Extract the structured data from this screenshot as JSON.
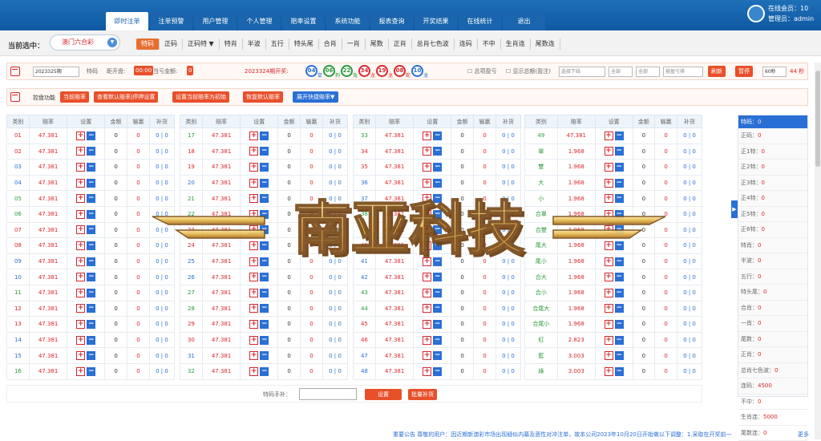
{
  "topnav": [
    "即时注单",
    "注单预警",
    "用户管理",
    "个人管理",
    "赔率设置",
    "系统功能",
    "报表查询",
    "开奖结果",
    "在线统计",
    "退出"
  ],
  "topinfo": {
    "online": "在线会员：10",
    "admin": "管理员：admin"
  },
  "current": {
    "label": "当前选中：",
    "value": "澳门六合彩"
  },
  "playtabs": [
    "特码",
    "正码",
    "正码特 ▼",
    "特肖",
    "半波",
    "五行",
    "特头尾",
    "合肖",
    "一肖",
    "尾数",
    "正肖",
    "总肖七色波",
    "连码",
    "不中",
    "生肖连",
    "尾数连"
  ],
  "ctrl1": {
    "period": "2023325期",
    "tema": "特码",
    "countdown_label": "距开盘:",
    "countdown": "00:00",
    "profit_label": "当亏金额:",
    "profit": "0",
    "last_label": "2023324期开奖:",
    "balls": [
      {
        "n": "04",
        "z": "鼠",
        "c": "blue"
      },
      {
        "n": "06",
        "z": "狗",
        "c": "green"
      },
      {
        "n": "22",
        "z": "兔",
        "c": "green"
      },
      {
        "n": "34",
        "z": "龙",
        "c": "red"
      },
      {
        "n": "19",
        "z": "龙",
        "c": "red"
      },
      {
        "n": "08",
        "z": "蛇",
        "c": "red"
      },
      {
        "n": "10",
        "z": "龙",
        "c": "blue"
      }
    ],
    "chk1": "总项盈亏",
    "chk2": "显示总额(盈注)",
    "sel1": "选择下线",
    "sel2": "全部",
    "sel3": "全部",
    "sel4": "按盈亏排",
    "refresh": "刷新",
    "pause": "暂停",
    "timer": "60秒",
    "timer_right": "44 秒"
  },
  "ctrl2": {
    "label": "控盘功能",
    "b1": "当前赔率",
    "b2": "查看默认赔率|停押设置",
    "b3": "设置当前赔率为初始",
    "b4": "恢复默认赔率",
    "b5": "展开快捷赔率▼"
  },
  "headers": [
    "类别",
    "赔率",
    "设置",
    "金额",
    "输赢",
    "补货"
  ],
  "table1": [
    {
      "k": "01",
      "c": "red"
    },
    {
      "k": "02",
      "c": "red"
    },
    {
      "k": "03",
      "c": "blue"
    },
    {
      "k": "04",
      "c": "blue"
    },
    {
      "k": "05",
      "c": "green"
    },
    {
      "k": "06",
      "c": "green"
    },
    {
      "k": "07",
      "c": "red"
    },
    {
      "k": "08",
      "c": "red"
    },
    {
      "k": "09",
      "c": "blue"
    },
    {
      "k": "10",
      "c": "blue"
    },
    {
      "k": "11",
      "c": "green"
    },
    {
      "k": "12",
      "c": "red"
    },
    {
      "k": "13",
      "c": "red"
    },
    {
      "k": "14",
      "c": "blue"
    },
    {
      "k": "15",
      "c": "blue"
    },
    {
      "k": "16",
      "c": "green"
    }
  ],
  "table2": [
    {
      "k": "17",
      "c": "green"
    },
    {
      "k": "18",
      "c": "red"
    },
    {
      "k": "19",
      "c": "red"
    },
    {
      "k": "20",
      "c": "blue"
    },
    {
      "k": "21",
      "c": "green"
    },
    {
      "k": "22",
      "c": "green"
    },
    {
      "k": "23",
      "c": "red"
    },
    {
      "k": "24",
      "c": "red"
    },
    {
      "k": "25",
      "c": "blue"
    },
    {
      "k": "26",
      "c": "blue"
    },
    {
      "k": "27",
      "c": "green"
    },
    {
      "k": "28",
      "c": "green"
    },
    {
      "k": "29",
      "c": "red"
    },
    {
      "k": "30",
      "c": "red"
    },
    {
      "k": "31",
      "c": "blue"
    },
    {
      "k": "32",
      "c": "green"
    }
  ],
  "table3": [
    {
      "k": "33",
      "c": "green"
    },
    {
      "k": "34",
      "c": "red"
    },
    {
      "k": "35",
      "c": "red"
    },
    {
      "k": "36",
      "c": "blue"
    },
    {
      "k": "37",
      "c": "blue"
    },
    {
      "k": "38",
      "c": "green"
    },
    {
      "k": "39",
      "c": "green"
    },
    {
      "k": "40",
      "c": "red"
    },
    {
      "k": "41",
      "c": "blue"
    },
    {
      "k": "42",
      "c": "blue"
    },
    {
      "k": "43",
      "c": "green"
    },
    {
      "k": "44",
      "c": "green"
    },
    {
      "k": "45",
      "c": "red"
    },
    {
      "k": "46",
      "c": "red"
    },
    {
      "k": "47",
      "c": "blue"
    },
    {
      "k": "48",
      "c": "blue"
    }
  ],
  "table4": [
    {
      "k": "49",
      "o": "47.381"
    },
    {
      "k": "單",
      "o": "1.968"
    },
    {
      "k": "雙",
      "o": "1.968"
    },
    {
      "k": "大",
      "o": "1.968"
    },
    {
      "k": "小",
      "o": "1.968"
    },
    {
      "k": "合單",
      "o": "1.968"
    },
    {
      "k": "合雙",
      "o": "1.968"
    },
    {
      "k": "尾大",
      "o": "1.968"
    },
    {
      "k": "尾小",
      "o": "1.968"
    },
    {
      "k": "合大",
      "o": "1.968"
    },
    {
      "k": "合小",
      "o": "1.968"
    },
    {
      "k": "合尾大",
      "o": "1.968"
    },
    {
      "k": "合尾小",
      "o": "1.968"
    },
    {
      "k": "紅",
      "o": "2.823"
    },
    {
      "k": "藍",
      "o": "3.003"
    },
    {
      "k": "綠",
      "o": "3.003"
    }
  ],
  "odds": "47.381",
  "zero": "0",
  "pipe": "0 | 0",
  "sidepanel": {
    "title": "特码：",
    "title_v": "0",
    "rows": [
      [
        "正码：",
        "0"
      ],
      [
        "正1特：",
        "0"
      ],
      [
        "正2特：",
        "0"
      ],
      [
        "正3特：",
        "0"
      ],
      [
        "正4特：",
        "0"
      ],
      [
        "正5特：",
        "0"
      ],
      [
        "正6特：",
        "0"
      ],
      [
        "特肖：",
        "0"
      ],
      [
        "半波：",
        "0"
      ],
      [
        "五行：",
        "0"
      ],
      [
        "特头尾：",
        "0"
      ],
      [
        "合肖：",
        "0"
      ],
      [
        "一肖：",
        "0"
      ],
      [
        "尾数：",
        "0"
      ],
      [
        "正肖：",
        "0"
      ],
      [
        "总肖七色波：",
        "0"
      ],
      [
        "连码：",
        "4500"
      ],
      [
        "不中：",
        "0"
      ],
      [
        "生肖连：",
        "5000"
      ],
      [
        "尾数连：",
        "0"
      ]
    ]
  },
  "bottom": {
    "label": "特码手补：",
    "set": "设置",
    "batch": "批量补货"
  },
  "marquee": "重要公告  尊敬的用户：因近期新澳彩市场出现疑似内幕及恶性对冲注单，故本公司2023年10月20日开始做以下调整：1.采取在开奖前一",
  "more": "更多",
  "watermark": "南亚科技"
}
